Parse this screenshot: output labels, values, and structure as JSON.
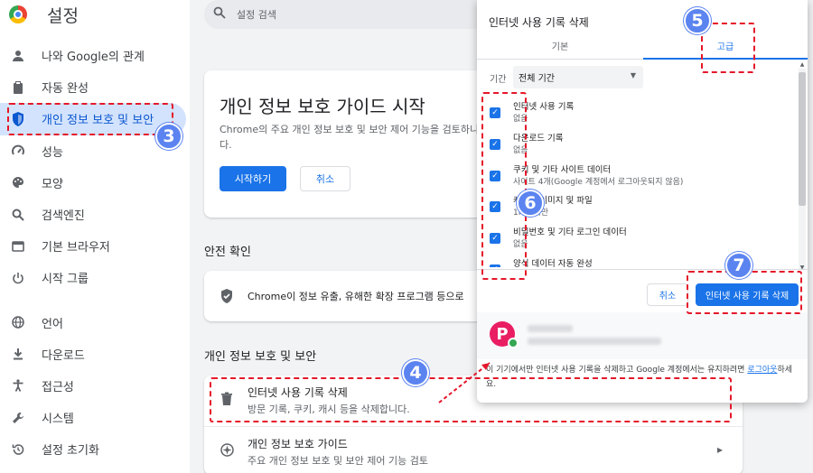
{
  "app": {
    "title": "설정"
  },
  "sidebar": {
    "items": [
      {
        "label": "나와 Google의 관계",
        "icon": "person-icon"
      },
      {
        "label": "자동 완성",
        "icon": "clipboard-icon"
      },
      {
        "label": "개인 정보 보호 및 보안",
        "icon": "shield-icon",
        "active": true
      },
      {
        "label": "성능",
        "icon": "speedometer-icon"
      },
      {
        "label": "모양",
        "icon": "palette-icon"
      },
      {
        "label": "검색엔진",
        "icon": "search-icon"
      },
      {
        "label": "기본 브라우저",
        "icon": "browser-icon"
      },
      {
        "label": "시작 그룹",
        "icon": "power-icon"
      },
      {
        "label": "언어",
        "icon": "globe-icon"
      },
      {
        "label": "다운로드",
        "icon": "download-icon"
      },
      {
        "label": "접근성",
        "icon": "accessibility-icon"
      },
      {
        "label": "시스템",
        "icon": "wrench-icon"
      },
      {
        "label": "설정 초기화",
        "icon": "history-icon"
      }
    ]
  },
  "search": {
    "placeholder": "설정 검색"
  },
  "guide_card": {
    "title": "개인 정보 보호 가이드 시작",
    "description": "Chrome의 주요 개인 정보 보호 및 보안 제어 기능을 검토하니다.",
    "start_label": "시작하기",
    "cancel_label": "취소"
  },
  "safety": {
    "section_title": "안전 확인",
    "text": "Chrome이 정보 유출, 유해한 확장 프로그램 등으로"
  },
  "privacy": {
    "section_title": "개인 정보 보호 및 보안",
    "rows": [
      {
        "title": "인터넷 사용 기록 삭제",
        "subtitle": "방문 기록, 쿠키, 캐시 등을 삭제합니다.",
        "icon": "trash-icon"
      },
      {
        "title": "개인 정보 보호 가이드",
        "subtitle": "주요 개인 정보 보호 및 보안 제어 기능 검토",
        "icon": "compass-icon"
      }
    ]
  },
  "dialog": {
    "title": "인터넷 사용 기록 삭제",
    "tabs": [
      "기본",
      "고급"
    ],
    "range_label": "기간",
    "range_value": "전체 기간",
    "items": [
      {
        "title": "인터넷 사용 기록",
        "subtitle": "없음",
        "checked": true
      },
      {
        "title": "다운로드 기록",
        "subtitle": "없음",
        "checked": true
      },
      {
        "title": "쿠키 및 기타 사이트 데이터",
        "subtitle": "사이트 4개(Google 계정에서 로그아웃되지 않음)",
        "checked": true
      },
      {
        "title": "캐시된 이미지 및 파일",
        "subtitle": "1MB 미만",
        "checked": true
      },
      {
        "title": "비밀번호 및 기타 로그인 데이터",
        "subtitle": "없음",
        "checked": true
      },
      {
        "title": "양식 데이터 자동 완성",
        "subtitle": "",
        "checked": true
      }
    ],
    "cancel_label": "취소",
    "delete_label": "인터넷 사용 기록 삭제",
    "avatar_letter": "P",
    "note_text": "이 기기에서만 인터넷 사용 기록을 삭제하고 Google 계정에서는 유지하려면 ",
    "note_link": "로그아웃",
    "note_end": "하세요."
  },
  "annotations": {
    "badges": [
      "3",
      "4",
      "5",
      "6",
      "7"
    ],
    "color": "#e5172a",
    "badge_color": "#5b84f0"
  }
}
